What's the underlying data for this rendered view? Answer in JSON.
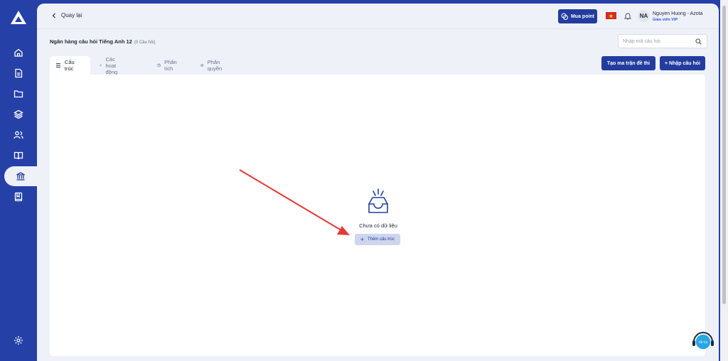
{
  "colors": {
    "sidebar": "#2541a8",
    "primary": "#233c9f",
    "background": "#eef1f7",
    "accent_red": "#e53935"
  },
  "sidebar": {
    "items": [
      {
        "icon": "home-icon"
      },
      {
        "icon": "document-icon"
      },
      {
        "icon": "folder-icon"
      },
      {
        "icon": "layers-icon"
      },
      {
        "icon": "users-icon"
      },
      {
        "icon": "book-open-icon"
      },
      {
        "icon": "bank-icon",
        "active": true
      },
      {
        "icon": "notebook-icon"
      }
    ],
    "bottom_icon": "settings-icon"
  },
  "header": {
    "back_label": "Quay lại",
    "buy_label": "Mua point",
    "user_initials": "NA",
    "user_name": "Nguyen Huong - Azota",
    "user_role": "Giáo viên VIP"
  },
  "bank": {
    "title": "Ngân hàng câu hỏi Tiếng Anh 12",
    "count": "(0 Câu hỏi)"
  },
  "search": {
    "placeholder": "Nhập mã câu hỏi"
  },
  "tabs": [
    {
      "label": "Cấu trúc",
      "icon": "list-icon",
      "active": true
    },
    {
      "label": "Các hoạt động",
      "icon": "users-icon"
    },
    {
      "label": "Phân tích",
      "icon": "chart-pie-icon"
    },
    {
      "label": "Phân quyền",
      "icon": "gear-icon"
    }
  ],
  "actions": {
    "create_matrix": "Tạo ma trận đề thi",
    "import_questions": "+ Nhập câu hỏi"
  },
  "empty_state": {
    "message": "Chưa có dữ liệu",
    "add_label": "Thêm cấu trúc"
  },
  "support": {
    "label": "Hỗ trợ"
  }
}
